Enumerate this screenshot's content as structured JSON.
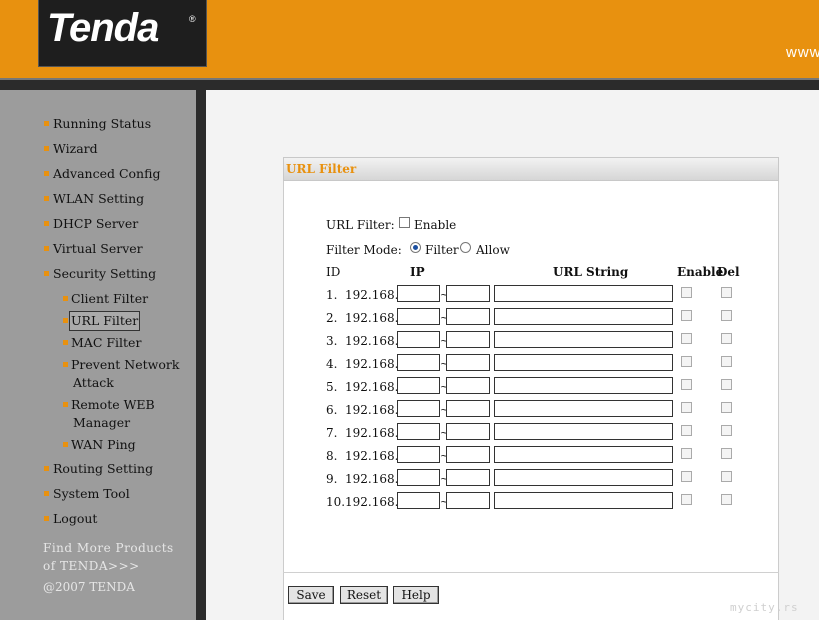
{
  "header": {
    "logo_text": "Tenda",
    "logo_reg": "®",
    "www": "www"
  },
  "sidebar": {
    "items": [
      {
        "label": "Running Status"
      },
      {
        "label": "Wizard"
      },
      {
        "label": "Advanced Config"
      },
      {
        "label": "WLAN Setting"
      },
      {
        "label": "DHCP Server"
      },
      {
        "label": "Virtual Server"
      },
      {
        "label": "Security Setting"
      },
      {
        "label": "Routing Setting"
      },
      {
        "label": "System Tool"
      },
      {
        "label": "Logout"
      }
    ],
    "security_sub": [
      {
        "label": "Client Filter"
      },
      {
        "label": "URL Filter",
        "selected": true
      },
      {
        "label": "MAC Filter"
      },
      {
        "label": "Prevent Network",
        "label2": "Attack"
      },
      {
        "label": "Remote WEB",
        "label2": "Manager"
      },
      {
        "label": "WAN Ping"
      }
    ],
    "find_more_line1": "Find More Products",
    "find_more_line2": "of TENDA>>>",
    "copyright": "@2007 TENDA"
  },
  "panel": {
    "title": "URL Filter",
    "url_filter_label": "URL Filter:",
    "enable_label": "Enable",
    "enable_checked": false,
    "filter_mode_label": "Filter Mode:",
    "mode_options": [
      "Filter",
      "Allow"
    ],
    "mode_selected": "Filter",
    "columns": {
      "id": "ID",
      "ip": "IP",
      "url": "URL String",
      "enable": "Enable",
      "del": "Del"
    },
    "ip_prefix": "192.168.0.",
    "ip_sep": "~",
    "rows": [
      {
        "id": "1.",
        "ip_start": "",
        "ip_end": "",
        "url": "",
        "enabled": false,
        "del": false
      },
      {
        "id": "2.",
        "ip_start": "",
        "ip_end": "",
        "url": "",
        "enabled": false,
        "del": false
      },
      {
        "id": "3.",
        "ip_start": "",
        "ip_end": "",
        "url": "",
        "enabled": false,
        "del": false
      },
      {
        "id": "4.",
        "ip_start": "",
        "ip_end": "",
        "url": "",
        "enabled": false,
        "del": false
      },
      {
        "id": "5.",
        "ip_start": "",
        "ip_end": "",
        "url": "",
        "enabled": false,
        "del": false
      },
      {
        "id": "6.",
        "ip_start": "",
        "ip_end": "",
        "url": "",
        "enabled": false,
        "del": false
      },
      {
        "id": "7.",
        "ip_start": "",
        "ip_end": "",
        "url": "",
        "enabled": false,
        "del": false
      },
      {
        "id": "8.",
        "ip_start": "",
        "ip_end": "",
        "url": "",
        "enabled": false,
        "del": false
      },
      {
        "id": "9.",
        "ip_start": "",
        "ip_end": "",
        "url": "",
        "enabled": false,
        "del": false
      },
      {
        "id": "10.",
        "ip_start": "",
        "ip_end": "",
        "url": "",
        "enabled": false,
        "del": false
      }
    ],
    "buttons": {
      "save": "Save",
      "reset": "Reset",
      "help": "Help"
    }
  },
  "watermark": "mycity.rs",
  "colors": {
    "accent": "#e8910f",
    "sidebar": "#9c9c9c",
    "dark_bar": "#2b2b2b"
  }
}
